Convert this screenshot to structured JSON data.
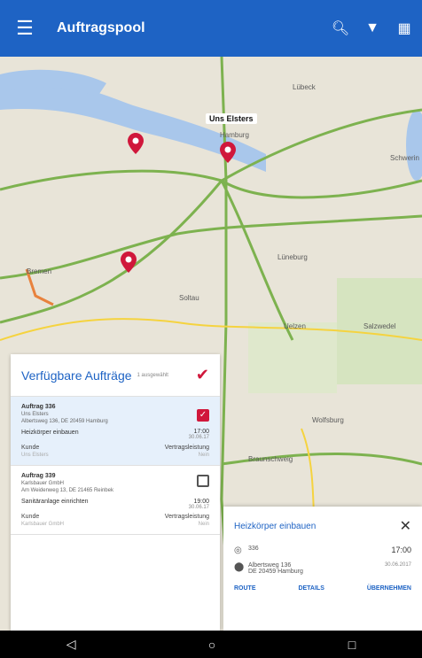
{
  "appbar": {
    "title": "Auftragspool",
    "menu_icon": "menu-icon",
    "action_icons": [
      "search-icon",
      "filter-icon",
      "calendar-icon"
    ],
    "color": "#1e63c4"
  },
  "map": {
    "callout": "Uns Elsters",
    "labels": [
      "Lübeck",
      "Hamburg",
      "Lüneburg",
      "Soltau",
      "Bremen",
      "Wolfsburg",
      "Braunschweig",
      "Salzwedel",
      "Uelzen",
      "Schwerin"
    ]
  },
  "panel": {
    "title": "Verfügbare Aufträge",
    "tag": "1 ausgewählt",
    "orders": [
      {
        "title": "Auftrag 336",
        "company": "Uns Elsters",
        "address": "Albertsweg 136, DE 20459 Hamburg",
        "work": "Heizkörper einbauen",
        "time": "17:00",
        "date": "30.06.17",
        "checked": true,
        "customer_label": "Kunde",
        "customer_value": "Uns Elsters",
        "type_label": "Vertragsleistung",
        "type_value": "Nein"
      },
      {
        "title": "Auftrag 339",
        "company": "Karlsbauer GmbH",
        "address": "Am Weidenweg 13, DE 21465 Reinbek",
        "work": "Sanitäranlage einrichten",
        "time": "19:00",
        "date": "30.06.17",
        "checked": false,
        "customer_label": "Kunde",
        "customer_value": "Karlsbauer GmbH",
        "type_label": "Vertragsleistung",
        "type_value": "Nein"
      }
    ]
  },
  "card": {
    "title": "Heizkörper einbauen",
    "order_no": "336",
    "address_line1": "Albertsweg 136",
    "address_line2": "DE 20459 Hamburg",
    "time": "17:00",
    "date": "30.06.2017",
    "actions": [
      "ROUTE",
      "DETAILS",
      "ÜBERNEHMEN"
    ]
  },
  "navbar": {
    "icons": [
      "back-icon",
      "home-icon",
      "recents-icon"
    ]
  }
}
